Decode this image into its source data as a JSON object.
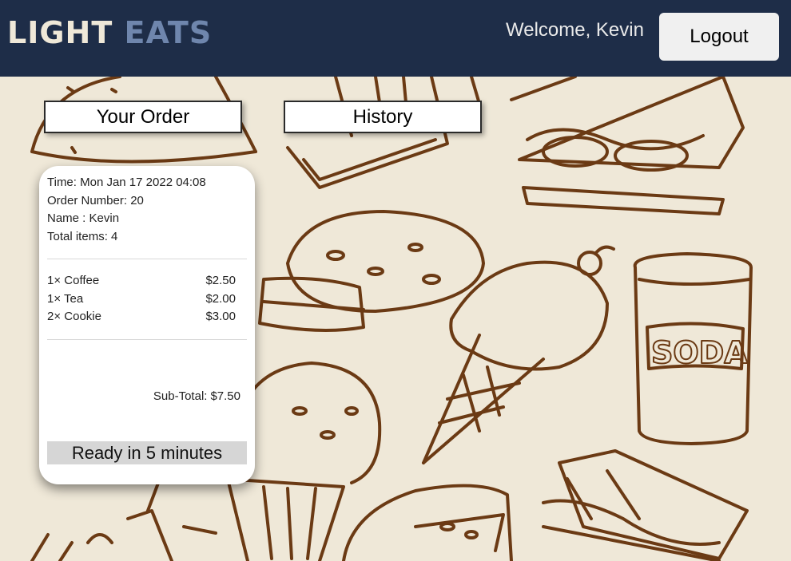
{
  "header": {
    "logo_word1": "LIGHT",
    "logo_word2": "EATS",
    "welcome_text": "Welcome, Kevin",
    "logout_label": "Logout"
  },
  "tabs": [
    {
      "label": "Your Order",
      "active": true
    },
    {
      "label": "History",
      "active": false
    }
  ],
  "order": {
    "time": "Time: Mon Jan 17 2022 04:08",
    "order_number": "Order Number: 20",
    "name": "Name : Kevin",
    "total_items": "Total items: 4",
    "items": [
      {
        "label": "1× Coffee",
        "price": "$2.50"
      },
      {
        "label": "1× Tea",
        "price": "$2.00"
      },
      {
        "label": "2× Cookie",
        "price": "$3.00"
      }
    ],
    "subtotal_label": "Sub-Total:",
    "subtotal_value": "$7.50",
    "status": "Ready in 5 minutes"
  },
  "colors": {
    "header_bg": "#1e2d48",
    "logo_accent": "#6f86ad",
    "page_bg": "#efe8d8",
    "doodle_stroke": "#6b3a14"
  }
}
